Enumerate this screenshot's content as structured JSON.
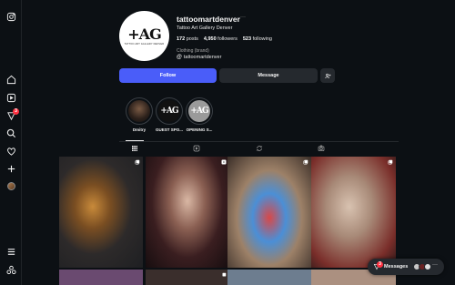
{
  "profile": {
    "logo_text": "+AG",
    "logo_sub": "TATTOO ART GALLERY DENVER",
    "username": "tattoomartdenver",
    "more": "···",
    "tagline": "Tattoo Art Gallery Denver",
    "stats": [
      {
        "count": "172",
        "label": "posts"
      },
      {
        "count": "4,950",
        "label": "followers"
      },
      {
        "count": "523",
        "label": "following"
      }
    ],
    "category": "Clothing (brand)",
    "threads_handle": "tattoomartdenver"
  },
  "buttons": {
    "follow": "Follow",
    "message": "Message",
    "suggest": "+≗"
  },
  "highlights": [
    {
      "label": "Dmitry",
      "inner": ""
    },
    {
      "label": "GUEST SPO...",
      "inner": "+AG"
    },
    {
      "label": "OPENING S...",
      "inner": "+AG"
    }
  ],
  "tabs": [
    "posts-grid",
    "reels",
    "reposts",
    "tagged"
  ],
  "messages": {
    "label": "Messages",
    "badge": "3"
  },
  "notifications_badge": "3",
  "colors": {
    "background": "#0c1014",
    "follow_button": "#4a5df9",
    "secondary_button": "#25292e",
    "badge": "#ff3040"
  },
  "icons": {
    "rail": [
      "instagram-icon",
      "home-icon",
      "reels-icon",
      "notifications-icon",
      "search-icon",
      "heart-icon",
      "create-icon",
      "profile-avatar",
      "menu-icon",
      "threads-apps-icon"
    ]
  }
}
